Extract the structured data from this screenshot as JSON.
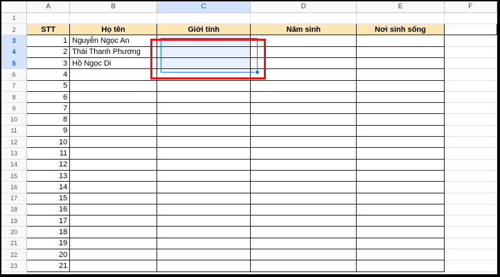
{
  "columns": [
    "A",
    "B",
    "C",
    "D",
    "E",
    "F"
  ],
  "header_row": {
    "stt": "STT",
    "ho_ten": "Họ tên",
    "gioi_tinh": "Giới tính",
    "nam_sinh": "Năm sinh",
    "noi_sinh_song": "Nơi sinh sống"
  },
  "row_numbers": [
    "1",
    "2",
    "3",
    "4",
    "5",
    "6",
    "7",
    "8",
    "9",
    "10",
    "11",
    "12",
    "13",
    "14",
    "15",
    "16",
    "17",
    "18",
    "19",
    "20",
    "21",
    "22",
    "23"
  ],
  "rows": [
    {
      "stt": "1",
      "ho_ten": "Nguyễn Ngọc An"
    },
    {
      "stt": "2",
      "ho_ten": "Thái Thanh Phương"
    },
    {
      "stt": "3",
      "ho_ten": "Hồ Ngọc Di"
    },
    {
      "stt": "4",
      "ho_ten": ""
    },
    {
      "stt": "5",
      "ho_ten": ""
    },
    {
      "stt": "6",
      "ho_ten": ""
    },
    {
      "stt": "7",
      "ho_ten": ""
    },
    {
      "stt": "8",
      "ho_ten": ""
    },
    {
      "stt": "9",
      "ho_ten": ""
    },
    {
      "stt": "10",
      "ho_ten": ""
    },
    {
      "stt": "11",
      "ho_ten": ""
    },
    {
      "stt": "12",
      "ho_ten": ""
    },
    {
      "stt": "13",
      "ho_ten": ""
    },
    {
      "stt": "14",
      "ho_ten": ""
    },
    {
      "stt": "15",
      "ho_ten": ""
    },
    {
      "stt": "16",
      "ho_ten": ""
    },
    {
      "stt": "17",
      "ho_ten": ""
    },
    {
      "stt": "18",
      "ho_ten": ""
    },
    {
      "stt": "19",
      "ho_ten": ""
    },
    {
      "stt": "20",
      "ho_ten": ""
    },
    {
      "stt": "21",
      "ho_ten": ""
    }
  ],
  "colors": {
    "header_fill": "#fce7b2",
    "selection_blue": "#1a73e8",
    "annotation_red": "#e5161c"
  }
}
